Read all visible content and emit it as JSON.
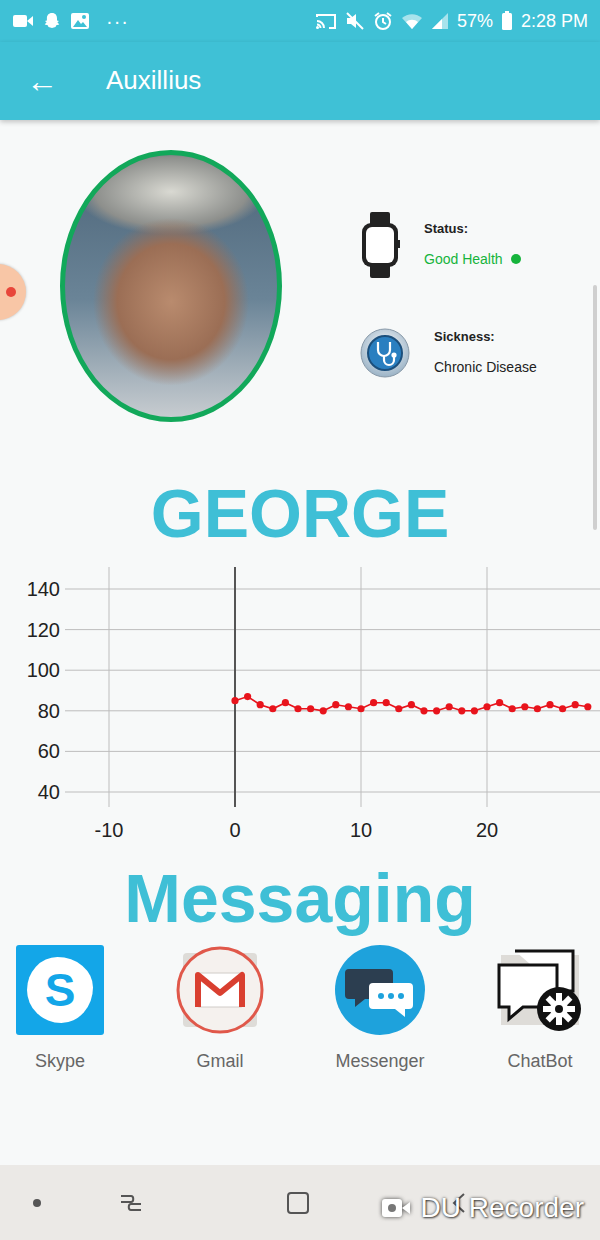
{
  "status_bar": {
    "more": "···",
    "battery": "57%",
    "time": "2:28 PM"
  },
  "app_bar": {
    "back": "←",
    "title": "Auxillius"
  },
  "profile": {
    "name": "GEORGE",
    "status": {
      "label": "Status:",
      "value": "Good Health",
      "healthy": true
    },
    "sickness": {
      "label": "Sickness:",
      "value": "Chronic Disease"
    }
  },
  "chart": {
    "y_ticks": [
      "140",
      "120",
      "100",
      "80",
      "60",
      "40"
    ],
    "x_ticks": [
      "-10",
      "0",
      "10",
      "20"
    ],
    "series": [
      {
        "values": [
          85,
          87,
          83,
          81,
          84,
          81,
          81,
          80,
          83,
          82,
          81,
          84,
          84,
          81,
          83,
          80,
          80,
          82,
          80,
          80,
          82,
          84,
          81,
          82,
          81,
          83,
          81,
          83,
          82
        ]
      }
    ]
  },
  "messaging": {
    "title": "Messaging",
    "apps": [
      {
        "label": "Skype",
        "kind": "skype",
        "glyph": "S"
      },
      {
        "label": "Gmail",
        "kind": "gmail"
      },
      {
        "label": "Messenger",
        "kind": "messenger"
      },
      {
        "label": "ChatBot",
        "kind": "chatbot"
      }
    ]
  },
  "watermark": "DU Recorder"
}
